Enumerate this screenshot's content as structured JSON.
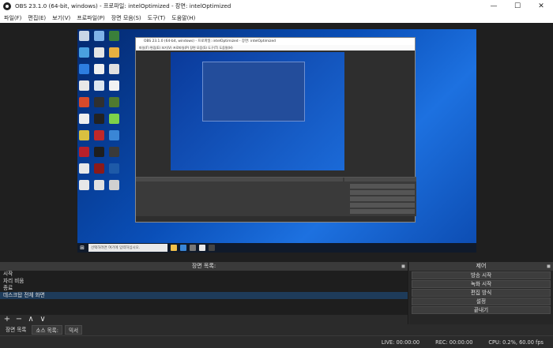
{
  "window": {
    "title": "OBS 23.1.0 (64-bit, windows) - 프로파일: intelOptimized - 장면: intelOptimized",
    "minimize_icon": "minimize-icon",
    "maximize_icon": "maximize-icon",
    "close_icon": "close-icon"
  },
  "menu": [
    "파일(F)",
    "편집(E)",
    "보기(V)",
    "프로파일(P)",
    "장면 모음(S)",
    "도구(T)",
    "도움말(H)"
  ],
  "scenes_dock": {
    "title": "장면 목록:",
    "items": [
      "시작",
      "자리 비움",
      "종료",
      "데스크탑 전체 화면"
    ],
    "selected_index": 3,
    "toolbar": [
      "+",
      "−",
      "∧",
      "∨"
    ]
  },
  "controls_dock": {
    "title": "제어",
    "buttons": [
      "방송 시작",
      "녹화 시작",
      "편집 방식",
      "설정",
      "끝내기"
    ]
  },
  "tabs": [
    "장면 목록",
    "소스 목록:",
    "믹서"
  ],
  "status": {
    "live": "LIVE: 00:00:00",
    "rec": "REC: 00:00:00",
    "cpu": "CPU: 0.2%, 60.00 fps"
  },
  "preview": {
    "taskbar_search": "선택하려면 여기에 입력하십시오."
  },
  "colors": {
    "background": "#2b2b2b",
    "selected_row": "#1e3b5a",
    "desktop_blue": "#0a4fb8"
  }
}
